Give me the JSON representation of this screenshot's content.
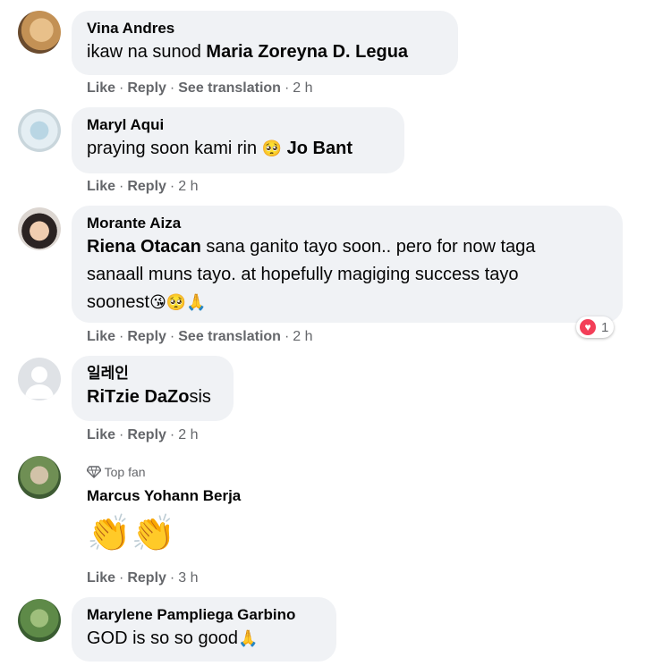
{
  "actions": {
    "like": "Like",
    "reply": "Reply",
    "see_translation": "See translation",
    "sep": "·"
  },
  "comments": [
    {
      "author": "Vina Andres",
      "text": "ikaw na sunod ",
      "tag": "Maria Zoreyna D. Legua",
      "time": "2 h"
    },
    {
      "author": "Maryl Aqui",
      "text": "praying soon kami rin ",
      "emoji": "🥺",
      "tag": "Jo Bant",
      "time": "2 h"
    },
    {
      "author": "Morante Aiza",
      "tag": "Riena Otacan",
      "text_line1": " sana ganito tayo soon.. pero for now taga",
      "text_line2": "sanaall muns tayo. at hopefully magiging success tayo",
      "text_line3": "soonest",
      "emojis": "😘🥺🙏",
      "time": "2 h",
      "reaction_count": "1"
    },
    {
      "author": "일레인",
      "tag_part1": "RiTzie DaZo",
      "tag_part2": "sis",
      "time": "2 h"
    },
    {
      "badge": "Top fan",
      "author": "Marcus Yohann Berja",
      "emoji": "👏👏",
      "time": "3 h"
    },
    {
      "author": "Marylene Pampliega Garbino",
      "text": "GOD is so so good",
      "emoji": "🙏",
      "time": ""
    }
  ],
  "icons": {
    "diamond": "diamond-icon",
    "heart": "heart-reaction-icon"
  }
}
